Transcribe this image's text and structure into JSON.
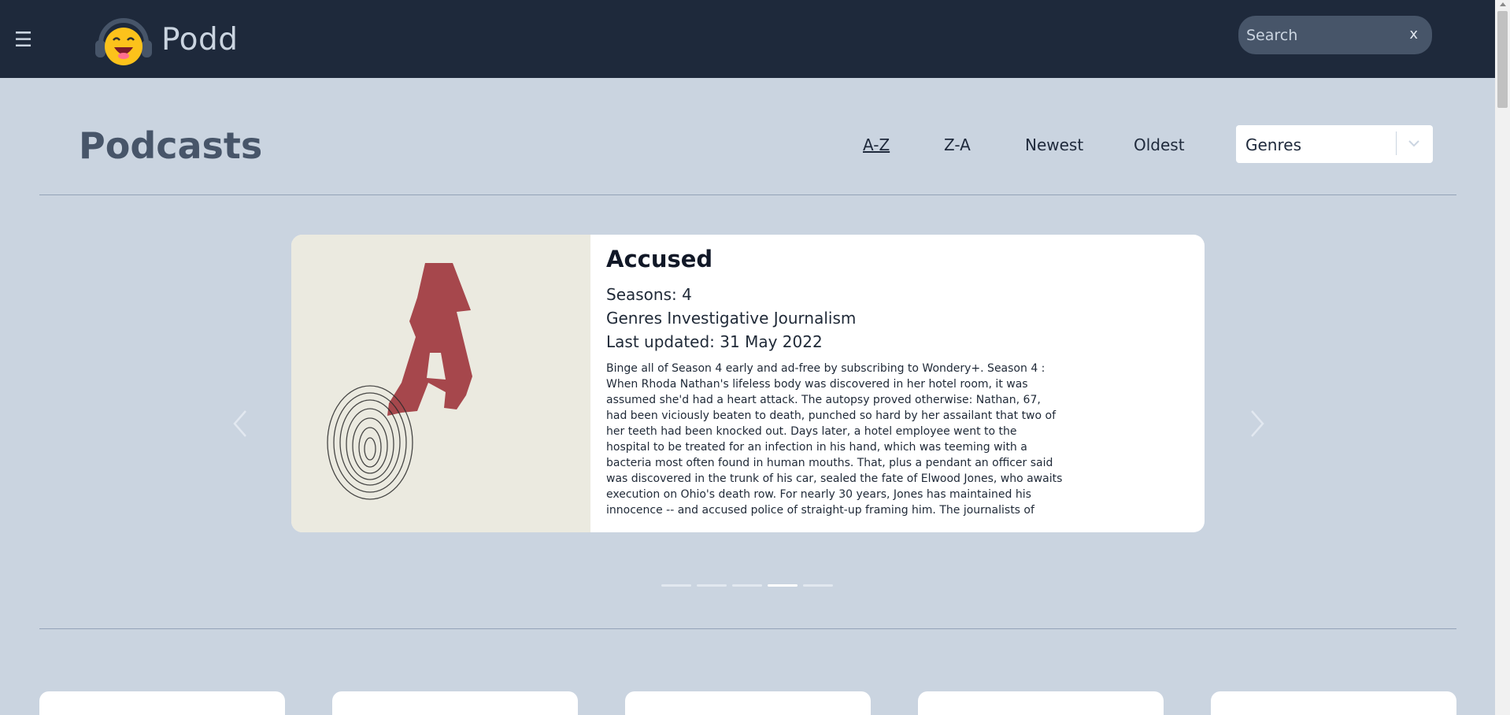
{
  "header": {
    "menu_icon": "hamburger-icon",
    "brand": "Podd",
    "logo_icon": "headphones-smiley-icon",
    "search": {
      "placeholder": "Search",
      "clear_label": "x"
    }
  },
  "toolbar": {
    "title": "Podcasts",
    "sort_options": [
      "A-Z",
      "Z-A",
      "Newest",
      "Oldest"
    ],
    "active_sort": "A-Z",
    "genres_label": "Genres"
  },
  "carousel": {
    "slides_total": 5,
    "active_index": 3,
    "featured": {
      "title": "Accused",
      "seasons": "Seasons: 4",
      "genres": "Genres Investigative Journalism",
      "updated": "Last updated: 31 May 2022",
      "description": "Binge all of Season 4 early and ad-free by subscribing to Wondery+. Season 4 : When Rhoda Nathan's lifeless body was discovered in her hotel room, it was assumed she'd had a heart attack. The autopsy proved otherwise: Nathan, 67, had been viciously beaten to death, punched so hard by her assailant that two of her teeth had been knocked out. Days later, a hotel employee went to the hospital to be treated for an infection in his hand, which was teeming with a bacteria most often found in human mouths. That, plus a pendant an officer said was discovered in the trunk of his car, sealed the fate of Elwood Jones, who awaits execution on Ohio's death row. For nearly 30 years, Jones has maintained his innocence -- and accused police of straight-up framing him. The journalists of Accused are reexamining the case to learn if Jones truly"
    }
  },
  "colors": {
    "header_bg": "#1e293b",
    "page_bg": "#cad4e0",
    "art_red": "#a0383f"
  }
}
